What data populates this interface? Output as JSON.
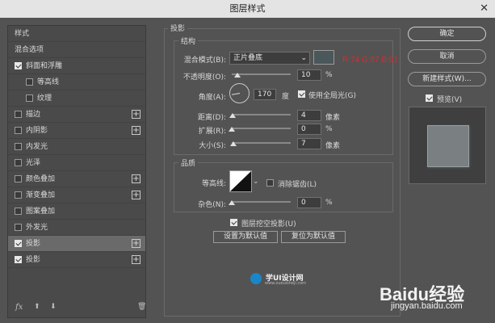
{
  "window": {
    "title": "图层样式",
    "close_glyph": "✕"
  },
  "left_panel": {
    "header": "样式",
    "blend_options": "混合选项",
    "items": [
      {
        "label": "斜面和浮雕",
        "checked": true,
        "indent": false,
        "plus": false
      },
      {
        "label": "等高线",
        "checked": false,
        "indent": true,
        "plus": false
      },
      {
        "label": "纹理",
        "checked": false,
        "indent": true,
        "plus": false
      },
      {
        "label": "描边",
        "checked": false,
        "indent": false,
        "plus": true
      },
      {
        "label": "内阴影",
        "checked": false,
        "indent": false,
        "plus": true
      },
      {
        "label": "内发光",
        "checked": false,
        "indent": false,
        "plus": false
      },
      {
        "label": "光泽",
        "checked": false,
        "indent": false,
        "plus": false
      },
      {
        "label": "颜色叠加",
        "checked": false,
        "indent": false,
        "plus": true
      },
      {
        "label": "渐变叠加",
        "checked": false,
        "indent": false,
        "plus": true
      },
      {
        "label": "图案叠加",
        "checked": false,
        "indent": false,
        "plus": false
      },
      {
        "label": "外发光",
        "checked": false,
        "indent": false,
        "plus": false
      },
      {
        "label": "投影",
        "checked": true,
        "indent": false,
        "plus": true,
        "selected": true
      },
      {
        "label": "投影",
        "checked": true,
        "indent": false,
        "plus": true
      }
    ],
    "bottom": {
      "fx": "fx",
      "up": "⬆",
      "down": "⬇",
      "trash": "🗑"
    }
  },
  "drop_shadow": {
    "section_title": "投影",
    "structure_title": "结构",
    "blend_mode_label": "混合模式(B):",
    "blend_mode_value": "正片叠底",
    "color_note": "R:74 G:87 B:91",
    "swatch_color": "#4a575b",
    "opacity_label": "不透明度(O):",
    "opacity_value": "10",
    "opacity_pct": 10,
    "angle_label": "角度(A):",
    "angle_value": "170",
    "angle_unit": "度",
    "global_light_label": "使用全局光(G)",
    "global_light_checked": true,
    "distance_label": "距离(D):",
    "distance_value": "4",
    "distance_unit": "像素",
    "distance_pct": 2,
    "spread_label": "扩展(R):",
    "spread_value": "0",
    "spread_unit": "%",
    "spread_pct": 0,
    "size_label": "大小(S):",
    "size_value": "7",
    "size_unit": "像素",
    "size_pct": 3,
    "pct_unit": "%",
    "quality_title": "品质",
    "contour_label": "等高线:",
    "antialias_label": "消除锯齿(L)",
    "antialias_checked": false,
    "noise_label": "杂色(N):",
    "noise_value": "0",
    "noise_unit": "%",
    "noise_pct": 0,
    "knockout_label": "图层挖空投影(U)",
    "knockout_checked": true,
    "make_default": "设置为默认值",
    "reset_default": "复位为默认值"
  },
  "right": {
    "ok": "确定",
    "cancel": "取消",
    "new_style": "新建样式(W)...",
    "preview_label": "预览(V)",
    "preview_checked": true
  },
  "watermark": {
    "logo_text": "学UI设计网",
    "logo_url_text": "www.xueuisheji.com",
    "baidu_brand": "Baidu经验",
    "baidu_url": "jingyan.baidu.com"
  }
}
